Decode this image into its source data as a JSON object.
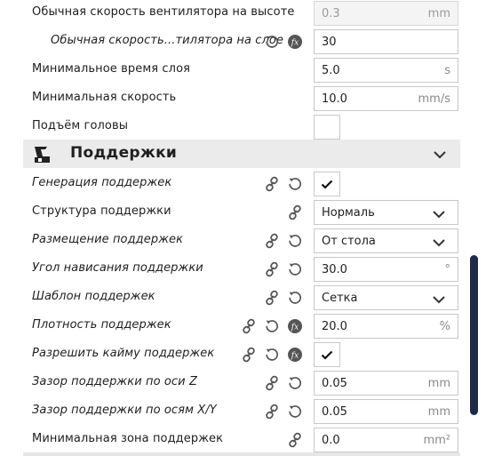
{
  "rows_top": [
    {
      "label": "Обычная скорость вентилятора на высоте",
      "value": "0.3",
      "unit": "mm",
      "disabled": true
    },
    {
      "label": "Обычная скорость...тилятора на слое",
      "value": "30",
      "unit": ""
    },
    {
      "label": "Минимальное время слоя",
      "value": "5.0",
      "unit": "s"
    },
    {
      "label": "Минимальная скорость",
      "value": "10.0",
      "unit": "mm/s"
    },
    {
      "label": "Подъём головы"
    }
  ],
  "section": {
    "title": "Поддержки",
    "icon": "support-icon"
  },
  "support_rows": [
    {
      "label": "Генерация поддержек"
    },
    {
      "label": "Структура поддержки",
      "value": "Нормаль"
    },
    {
      "label": "Размещение поддержек",
      "value": "От стола"
    },
    {
      "label": "Угол нависания поддержки",
      "value": "30.0",
      "unit": "°"
    },
    {
      "label": "Шаблон поддержек",
      "value": "Сетка"
    },
    {
      "label": "Плотность поддержек",
      "value": "20.0",
      "unit": "%"
    },
    {
      "label": "Разрешить кайму поддержек"
    },
    {
      "label": "Зазор поддержки по оси Z",
      "value": "0.05",
      "unit": "mm"
    },
    {
      "label": "Зазор поддержки по осям X/Y",
      "value": "0.05",
      "unit": "mm"
    },
    {
      "label": "Минимальная зона поддержек",
      "value": "0.0",
      "unit": "mm²"
    }
  ],
  "colors": {
    "accent_dark": "#1f2a4a",
    "section_bg": "#ebebeb",
    "icon": "#555555"
  }
}
